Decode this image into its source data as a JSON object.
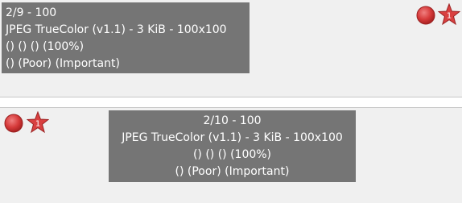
{
  "top_item": {
    "title": "2/9 - 100",
    "format": "JPEG TrueColor (v1.1) - 3 KiB - 100x100",
    "ratings": "() () () (100%)",
    "tags": "() (Poor) (Important)",
    "star_badge": "1"
  },
  "bottom_item": {
    "title": "2/10 - 100",
    "format": "JPEG TrueColor (v1.1) - 3 KiB - 100x100",
    "ratings": "() () () (100%)",
    "tags": "() (Poor) (Important)",
    "star_badge": "1"
  },
  "colors": {
    "panel_bg": "#f0f0f0",
    "info_bg": "#757575",
    "info_text": "#ffffff",
    "status_dot": "#d63a3a",
    "star": "#d94040"
  },
  "icons": [
    "red-status-dot-icon",
    "star-badge-icon"
  ]
}
